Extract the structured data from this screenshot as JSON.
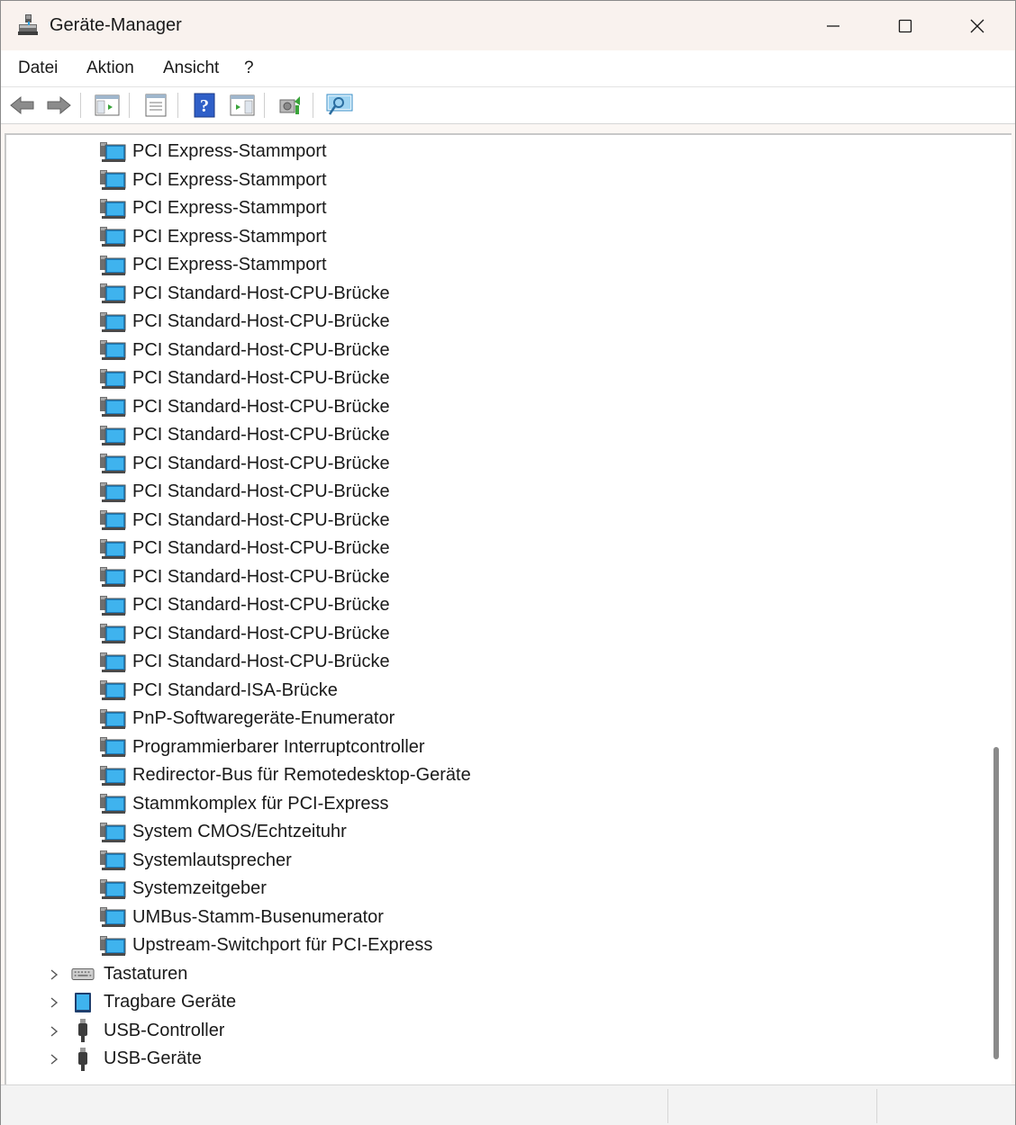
{
  "window": {
    "title": "Geräte-Manager",
    "controls": {
      "minimize": "minimize",
      "maximize": "maximize",
      "close": "close"
    }
  },
  "menu": {
    "items": [
      "Datei",
      "Aktion",
      "Ansicht",
      "?"
    ]
  },
  "toolbar": {
    "buttons": [
      "back-icon",
      "forward-icon",
      "show-hide-console-tree-icon",
      "properties-icon",
      "help-icon",
      "action-pane-icon",
      "update-driver-icon",
      "scan-hardware-icon"
    ]
  },
  "tree": {
    "devices": [
      "PCI Express-Stammport",
      "PCI Express-Stammport",
      "PCI Express-Stammport",
      "PCI Express-Stammport",
      "PCI Express-Stammport",
      "PCI Standard-Host-CPU-Brücke",
      "PCI Standard-Host-CPU-Brücke",
      "PCI Standard-Host-CPU-Brücke",
      "PCI Standard-Host-CPU-Brücke",
      "PCI Standard-Host-CPU-Brücke",
      "PCI Standard-Host-CPU-Brücke",
      "PCI Standard-Host-CPU-Brücke",
      "PCI Standard-Host-CPU-Brücke",
      "PCI Standard-Host-CPU-Brücke",
      "PCI Standard-Host-CPU-Brücke",
      "PCI Standard-Host-CPU-Brücke",
      "PCI Standard-Host-CPU-Brücke",
      "PCI Standard-Host-CPU-Brücke",
      "PCI Standard-Host-CPU-Brücke",
      "PCI Standard-ISA-Brücke",
      "PnP-Softwaregeräte-Enumerator",
      "Programmierbarer Interruptcontroller",
      "Redirector-Bus für Remotedesktop-Geräte",
      "Stammkomplex für PCI-Express",
      "System CMOS/Echtzeituhr",
      "Systemlautsprecher",
      "Systemzeitgeber",
      "UMBus-Stamm-Busenumerator",
      "Upstream-Switchport für PCI-Express"
    ],
    "categories": [
      {
        "label": "Tastaturen",
        "icon": "keyboard-icon"
      },
      {
        "label": "Tragbare Geräte",
        "icon": "portable-device-icon"
      },
      {
        "label": "USB-Controller",
        "icon": "usb-icon"
      },
      {
        "label": "USB-Geräte",
        "icon": "usb-icon"
      }
    ]
  },
  "colors": {
    "titlebar": "#f9f2ee",
    "device_icon_blue": "#2a9fe0",
    "scroll_thumb": "#8a8a8a"
  }
}
